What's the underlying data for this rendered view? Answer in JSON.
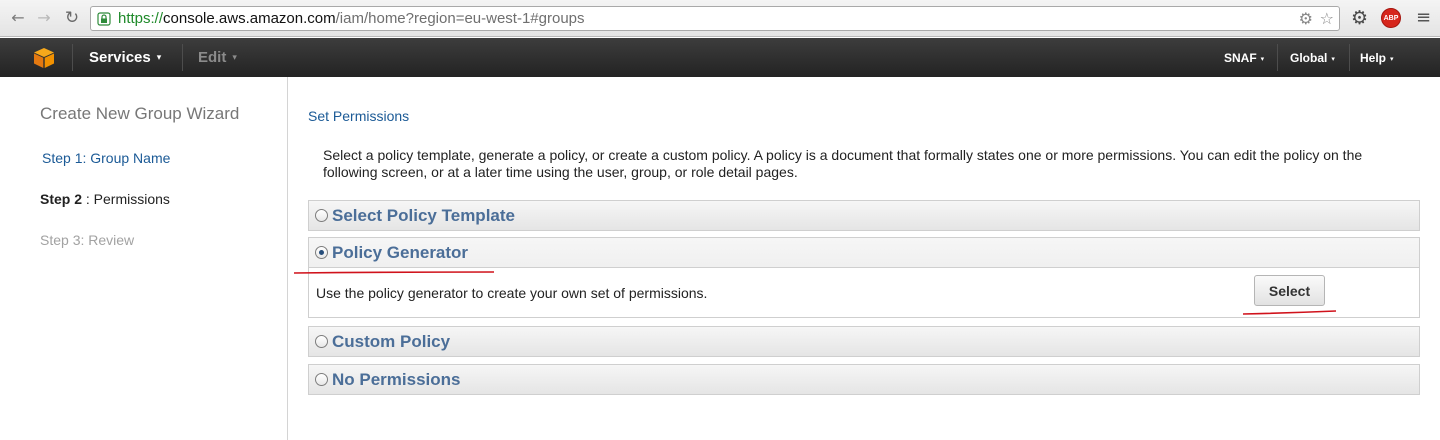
{
  "browser": {
    "url_scheme": "https://",
    "url_host": "console.aws.amazon.com",
    "url_path": "/iam/home?region=eu-west-1#groups",
    "abp_label": "ABP",
    "icons": [
      "back-icon",
      "forward-icon",
      "reload-icon",
      "lock-icon",
      "gear-icon",
      "star-icon",
      "settings-icon",
      "adblock-icon",
      "menu-icon"
    ]
  },
  "aws_nav": {
    "services_label": "Services",
    "edit_label": "Edit",
    "account_label": "SNAF",
    "region_label": "Global",
    "help_label": "Help",
    "caret": "▾"
  },
  "sidebar": {
    "title": "Create New Group Wizard",
    "step1": "Step 1: Group Name",
    "step2_bold": "Step 2",
    "step2_rest": " : Permissions",
    "step3": "Step 3: Review"
  },
  "main": {
    "section_title": "Set Permissions",
    "description": "Select a policy template, generate a policy, or create a custom policy. A policy is a document that formally states one or more permissions. You can edit the policy on the following screen, or at a later time using the user, group, or role detail pages.",
    "options": {
      "template": "Select Policy Template",
      "generator": "Policy Generator",
      "custom": "Custom Policy",
      "none": "No Permissions"
    },
    "selected_option": "Policy Generator",
    "generator_body": "Use the policy generator to create your own set of permissions.",
    "select_button": "Select"
  },
  "colors": {
    "annotation_underline": "#d0121b",
    "nav_bar": "#2b2b2b",
    "link_blue": "#1b5a96",
    "panel_label": "#4b6e98"
  }
}
